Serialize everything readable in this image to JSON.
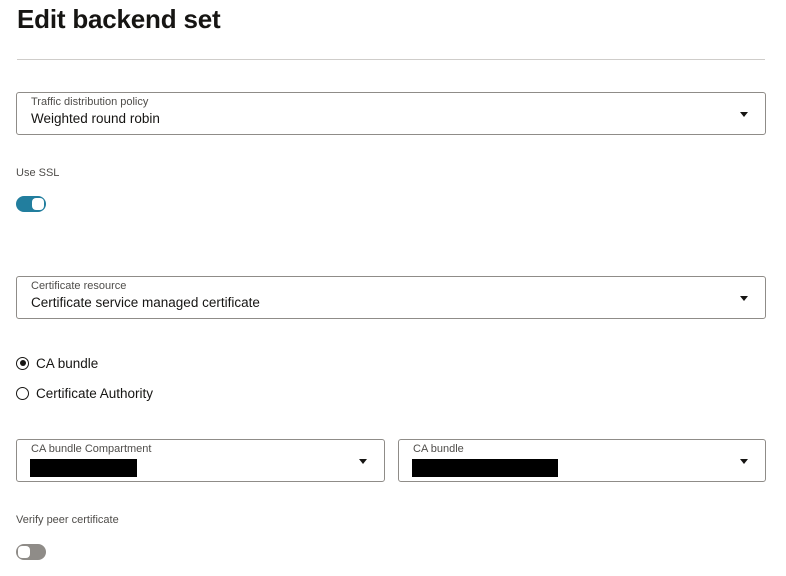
{
  "header": {
    "title": "Edit backend set"
  },
  "traffic_policy": {
    "label": "Traffic distribution policy",
    "value": "Weighted round robin"
  },
  "use_ssl": {
    "label": "Use SSL",
    "enabled": true,
    "accent_color": "#227e9e"
  },
  "certificate_resource": {
    "label": "Certificate resource",
    "value": "Certificate service managed certificate"
  },
  "trust_source": {
    "options": [
      {
        "label": "CA bundle",
        "selected": true
      },
      {
        "label": "Certificate Authority",
        "selected": false
      }
    ]
  },
  "ca_bundle_compartment": {
    "label": "CA bundle Compartment"
  },
  "ca_bundle": {
    "label": "CA bundle"
  },
  "verify_peer": {
    "label": "Verify peer certificate",
    "enabled": false
  }
}
